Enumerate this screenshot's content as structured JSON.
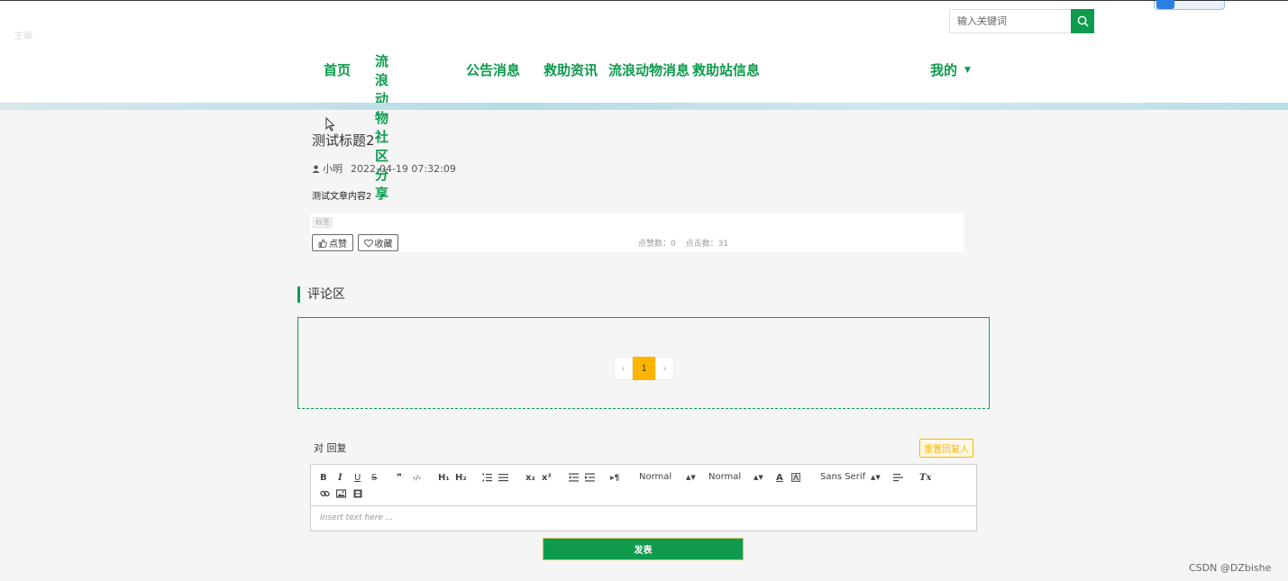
{
  "header": {
    "faint_text": "主编 ",
    "search": {
      "placeholder": "输入关键词"
    }
  },
  "nav": {
    "items": [
      {
        "label": "首页"
      },
      {
        "label": "流浪动物社区\n分享"
      },
      {
        "label": "公告消息"
      },
      {
        "label": "救助资讯"
      },
      {
        "label": "流浪动物消息"
      },
      {
        "label": "救助站信息"
      }
    ],
    "mine_label": "我的"
  },
  "article": {
    "title": "测试标题2",
    "author": "小明",
    "date": "2022-04-19 07:32:09",
    "content": "测试文章内容2",
    "tag": "标签",
    "like_label": "点赞",
    "favorite_label": "收藏",
    "likes_text": "点赞数：0",
    "clicks_text": "点击数：31"
  },
  "comments": {
    "section_title": "评论区",
    "pager": {
      "prev": "‹",
      "current": "1",
      "next": "›"
    }
  },
  "reply": {
    "label": "对 回复",
    "reset_label": "重置回复人",
    "editor": {
      "toolbar": {
        "bold": "B",
        "italic": "I",
        "underline": "U",
        "strike": "S",
        "blockquote": "❞",
        "code": "‹/›",
        "h1": "H₁",
        "h2": "H₂",
        "sub": "x₂",
        "sup": "x²",
        "rtl": "▸¶",
        "size_select": "Normal",
        "header_select": "Normal",
        "color": "A",
        "font_select": "Sans Serif",
        "clean": "Tx"
      },
      "placeholder": "Insert text here ..."
    },
    "submit_label": "发表"
  },
  "watermark": "CSDN @DZbishe",
  "colors": {
    "primary": "#0e9b4e",
    "accent": "#ffb400"
  }
}
